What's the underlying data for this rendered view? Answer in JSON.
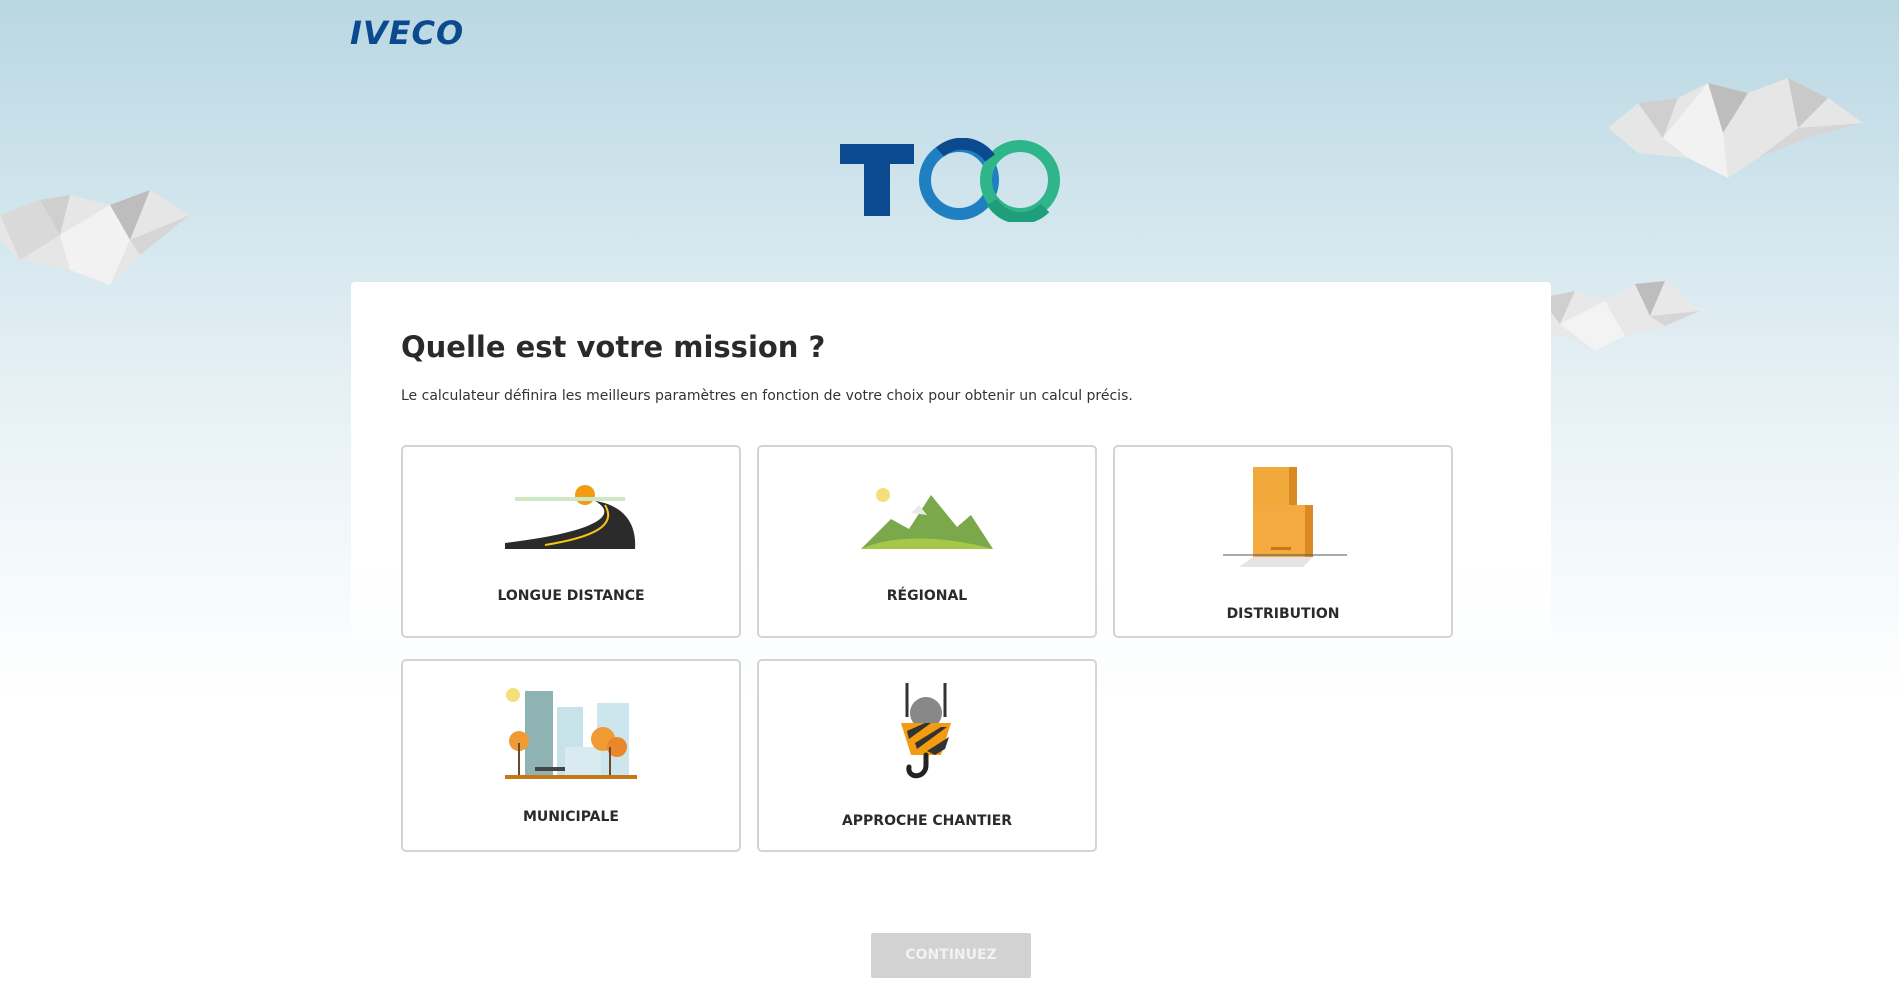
{
  "header": {
    "brand": "IVECO"
  },
  "app": {
    "logo_name": "TCO"
  },
  "mission": {
    "title": "Quelle est votre mission ?",
    "description": "Le calculateur définira les meilleurs paramètres en fonction de votre choix pour obtenir un calcul précis.",
    "options": [
      {
        "label": "LONGUE DISTANCE",
        "icon": "road-icon"
      },
      {
        "label": "RÉGIONAL",
        "icon": "hills-icon"
      },
      {
        "label": "DISTRIBUTION",
        "icon": "boxes-icon"
      },
      {
        "label": "MUNICIPALE",
        "icon": "city-icon"
      },
      {
        "label": "APPROCHE CHANTIER",
        "icon": "crane-hook-icon"
      }
    ]
  },
  "footer": {
    "continue_label": "CONTINUEZ"
  },
  "colors": {
    "brand": "#0b4a8f",
    "button_disabled": "#d2d2d2",
    "tile_border": "#d4d4d4"
  }
}
